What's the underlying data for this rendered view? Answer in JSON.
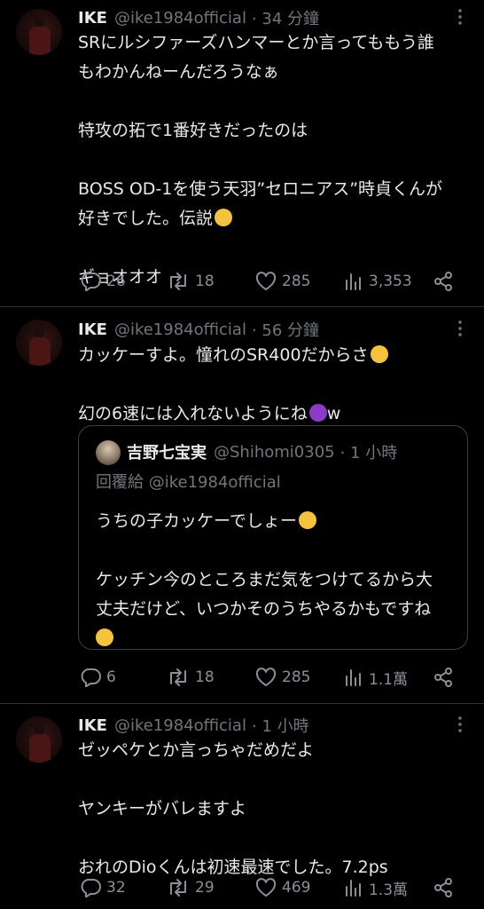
{
  "posts": [
    {
      "name": "IKE",
      "handle": "@ike1984official",
      "time": "· 34 分鐘",
      "lines": [
        "SRにルシファーズハンマーとか言ってももう誰",
        "もわかんねーんだろうなぁ",
        "",
        "特攻の拓で1番好きだったのは",
        "",
        "BOSS OD-1を使う天羽”セロニアス”時貞くんが",
        "好きでした。伝説",
        "",
        "ギョオオオ"
      ],
      "emoji_line": 6,
      "emoji_name": "tongue-emoji",
      "replies": "26",
      "reposts": "18",
      "likes": "285",
      "views": "3,353"
    },
    {
      "name": "IKE",
      "handle": "@ike1984official",
      "time": "· 56 分鐘",
      "lines": [
        "カッケーすよ。憧れのSR400だからさ",
        "",
        "幻の6速には入れないようにね"
      ],
      "line_suffix_2": "w",
      "replies": "6",
      "reposts": "18",
      "likes": "285",
      "views": "1.1萬",
      "quote": {
        "name": "吉野七宝実",
        "handle": "@Shihomi0305",
        "time": "· 1 小時",
        "reply_to": "回覆給 @ike1984official",
        "lines": [
          "うちの子カッケーでしょー",
          "",
          "ケッチン今のところまだ気をつけてるから大",
          "丈夫だけど、いつかそのうちやるかもですね"
        ]
      }
    },
    {
      "name": "IKE",
      "handle": "@ike1984official",
      "time": "· 1 小時",
      "lines": [
        "ゼッペケとか言っちゃだめだよ",
        "",
        "ヤンキーがバレますよ",
        "",
        "おれのDioくんは初速最速でした。7.2ps"
      ],
      "replies": "32",
      "reposts": "29",
      "likes": "469",
      "views": "1.3萬"
    }
  ]
}
